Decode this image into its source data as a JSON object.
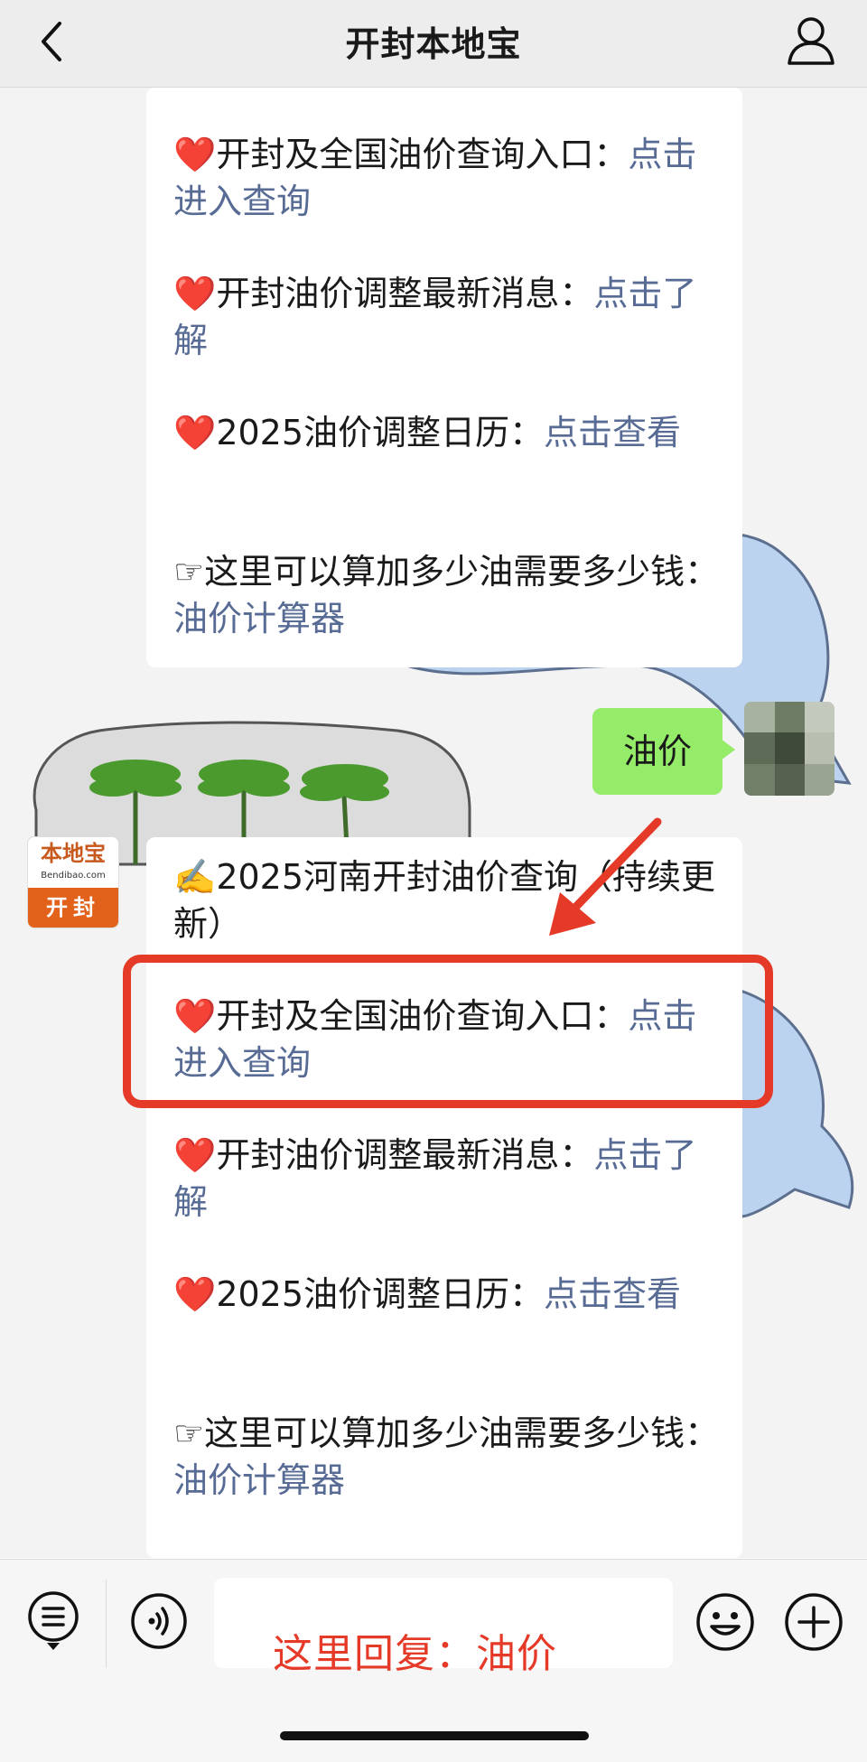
{
  "header": {
    "title": "开封本地宝"
  },
  "history": [
    {
      "icon": "❤️",
      "text": "开封及全国油价查询入口：",
      "link": "点击进入查询"
    },
    {
      "icon": "❤️",
      "text": "开封油价调整最新消息：",
      "link": "点击了解"
    },
    {
      "icon": "❤️",
      "text": "2025油价调整日历：",
      "link": "点击查看"
    },
    {
      "icon": "☞",
      "text": "这里可以算加多少油需要多少钱：",
      "link": "油价计算器"
    }
  ],
  "user_message": {
    "text": "油价"
  },
  "bot": {
    "avatar_main": "本地宝",
    "avatar_sub": "Bendibao.com",
    "avatar_city": "开封",
    "headline": {
      "icon": "✍️",
      "text": "2025河南开封油价查询（持续更新）"
    },
    "items": [
      {
        "icon": "❤️",
        "text": "开封及全国油价查询入口：",
        "link": "点击进入查询"
      },
      {
        "icon": "❤️",
        "text": "开封油价调整最新消息：",
        "link": "点击了解"
      },
      {
        "icon": "❤️",
        "text": "2025油价调整日历：",
        "link": "点击查看"
      },
      {
        "icon": "☞",
        "text": "这里可以算加多少油需要多少钱：",
        "link": "油价计算器"
      }
    ]
  },
  "annotation": {
    "reply_hint": "这里回复：油价",
    "highlight_color": "#e53a27"
  },
  "toolbar_icons": [
    "menu-icon",
    "voice-icon",
    "emoji-icon",
    "plus-icon"
  ],
  "colors": {
    "link": "#576b95",
    "user_bubble": "#95ec69",
    "topbar": "#ededed"
  }
}
